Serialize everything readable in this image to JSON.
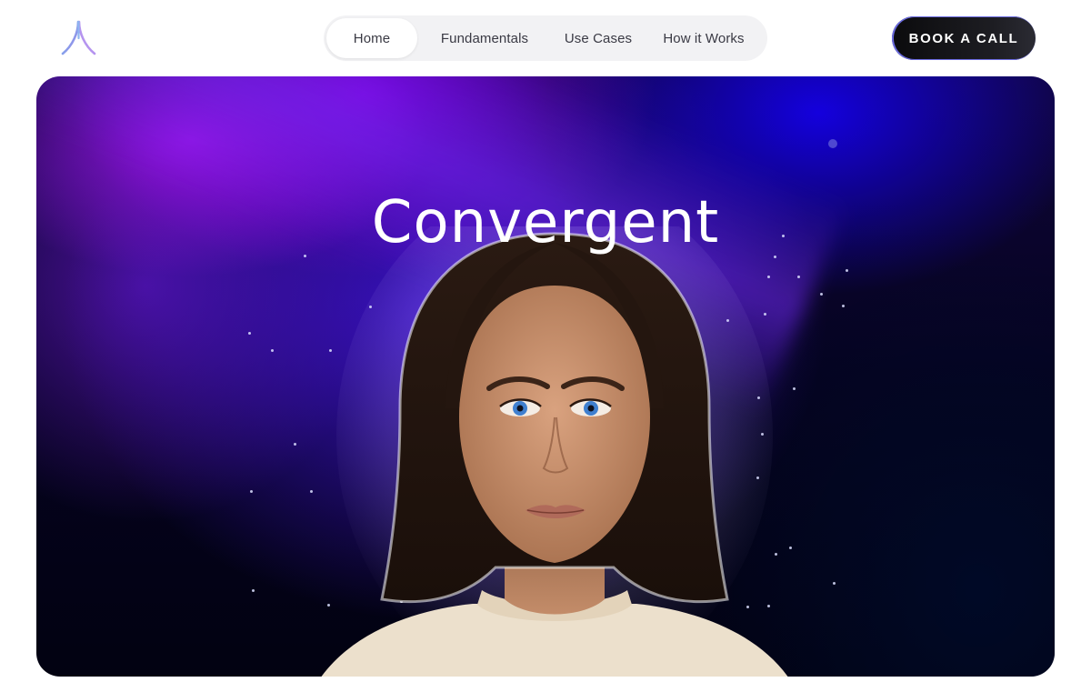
{
  "header": {
    "logo_icon": "convergent-logo-icon",
    "nav": [
      {
        "label": "Home",
        "active": true
      },
      {
        "label": "Fundamentals",
        "active": false
      },
      {
        "label": "Use Cases",
        "active": false
      },
      {
        "label": "How it Works",
        "active": false
      }
    ],
    "cta_label": "BOOK A CALL"
  },
  "hero": {
    "title": "Convergent",
    "background_colors": [
      "#7a00d6",
      "#1a00d8",
      "#050320"
    ],
    "portrait": "woman-portrait-illustration"
  }
}
